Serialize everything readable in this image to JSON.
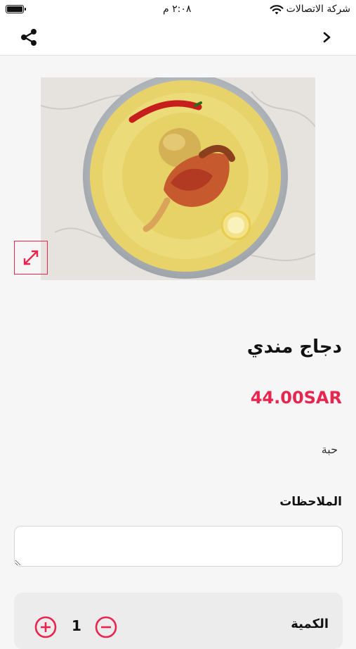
{
  "status_bar": {
    "carrier": "شركة الاتصالات",
    "time": "٢:٠٨ م"
  },
  "product": {
    "name": "دجاج مندي",
    "price": "44.00SAR",
    "unit": "حبة"
  },
  "notes": {
    "label": "الملاحظات",
    "value": ""
  },
  "quantity": {
    "label": "الكمية",
    "value": "1"
  },
  "colors": {
    "accent": "#e8254f",
    "background": "#f6f6f6"
  },
  "icons": {
    "share": "share-icon",
    "back": "chevron-right-icon",
    "expand": "expand-icon",
    "plus": "plus-circle-icon",
    "minus": "minus-circle-icon"
  }
}
